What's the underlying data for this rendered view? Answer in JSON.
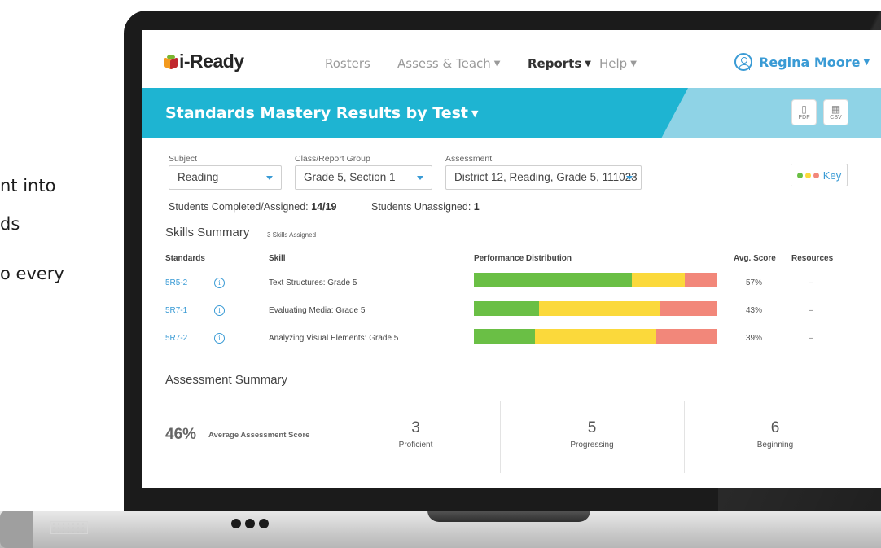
{
  "background_text": {
    "line1": "nt into",
    "line2": "ds",
    "line3": "o every"
  },
  "app": {
    "logo": "i-Ready"
  },
  "nav": {
    "items": [
      {
        "label": "Rosters",
        "dropdown": false,
        "active": false
      },
      {
        "label": "Assess & Teach",
        "dropdown": true,
        "active": false
      },
      {
        "label": "Reports",
        "dropdown": true,
        "active": true
      },
      {
        "label": "Help",
        "dropdown": true,
        "active": false
      }
    ],
    "user_name": "Regina Moore"
  },
  "header": {
    "title": "Standards Mastery Results by Test",
    "export_pdf": "PDF",
    "export_csv": "CSV"
  },
  "filters": {
    "subject": {
      "label": "Subject",
      "value": "Reading"
    },
    "class_group": {
      "label": "Class/Report Group",
      "value": "Grade 5, Section 1"
    },
    "assessment": {
      "label": "Assessment",
      "value": "District 12, Reading, Grade 5, 111023"
    },
    "key_label": "Key"
  },
  "stats": {
    "completed_label": "Students Completed/Assigned:",
    "completed_value": "14/19",
    "unassigned_label": "Students Unassigned:",
    "unassigned_value": "1"
  },
  "skills_summary": {
    "title": "Skills Summary",
    "assigned_note": "3 Skills Assigned",
    "headers": [
      "Standards",
      "Skill",
      "Performance Distribution",
      "Avg. Score",
      "Resources"
    ],
    "rows": [
      {
        "standard": "5R5-2",
        "skill": "Text Structures: Grade 5",
        "avg": "57%",
        "resources": "–",
        "dist": {
          "green": 0.65,
          "yellow": 0.22,
          "red": 0.13
        }
      },
      {
        "standard": "5R7-1",
        "skill": "Evaluating Media: Grade 5",
        "avg": "43%",
        "resources": "–",
        "dist": {
          "green": 0.27,
          "yellow": 0.5,
          "red": 0.23
        }
      },
      {
        "standard": "5R7-2",
        "skill": "Analyzing Visual Elements: Grade 5",
        "avg": "39%",
        "resources": "–",
        "dist": {
          "green": 0.25,
          "yellow": 0.5,
          "red": 0.25
        }
      }
    ]
  },
  "assessment_summary": {
    "title": "Assessment Summary",
    "average_score": "46%",
    "average_label": "Average Assessment Score",
    "proficient": {
      "count": "3",
      "label": "Proficient"
    },
    "progressing": {
      "count": "5",
      "label": "Progressing"
    },
    "beginning": {
      "count": "6",
      "label": "Beginning"
    }
  },
  "colors": {
    "header_teal": "#1eb4d2",
    "link_blue": "#3a9bd5",
    "proficient_green": "#6abf45",
    "progressing_yellow": "#fbd93b",
    "beginning_red": "#f2877a"
  }
}
